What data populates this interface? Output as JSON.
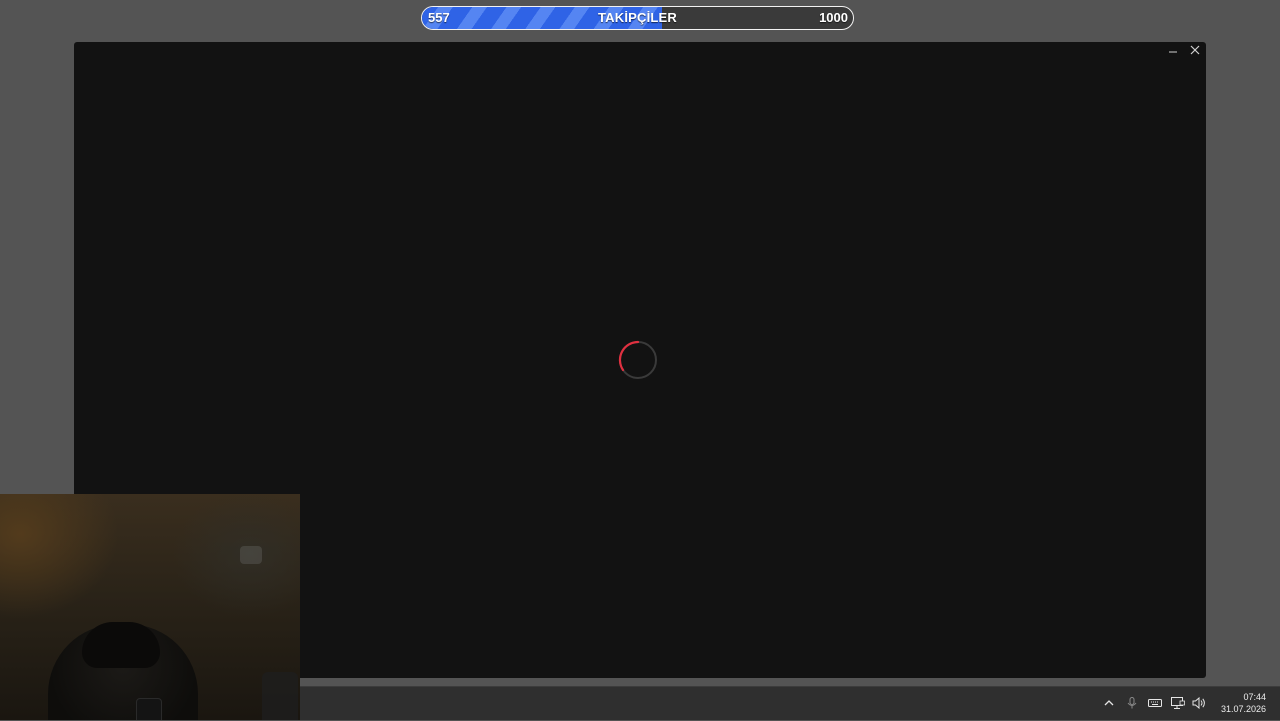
{
  "goal_bar": {
    "current": "557",
    "title": "TAKİPÇİLER",
    "target": "1000",
    "progress_fraction": 0.557,
    "fill_color": "#2f63e6"
  },
  "window": {
    "minimize_icon": "minimize-icon",
    "close_icon": "close-icon",
    "spinner_color": "#e03040"
  },
  "taskbar": {
    "tray_icons": [
      "chevron-up-icon",
      "microphone-icon",
      "keyboard-icon",
      "network-icon",
      "volume-icon"
    ],
    "time": "07:44",
    "date": "31.07.2026"
  }
}
